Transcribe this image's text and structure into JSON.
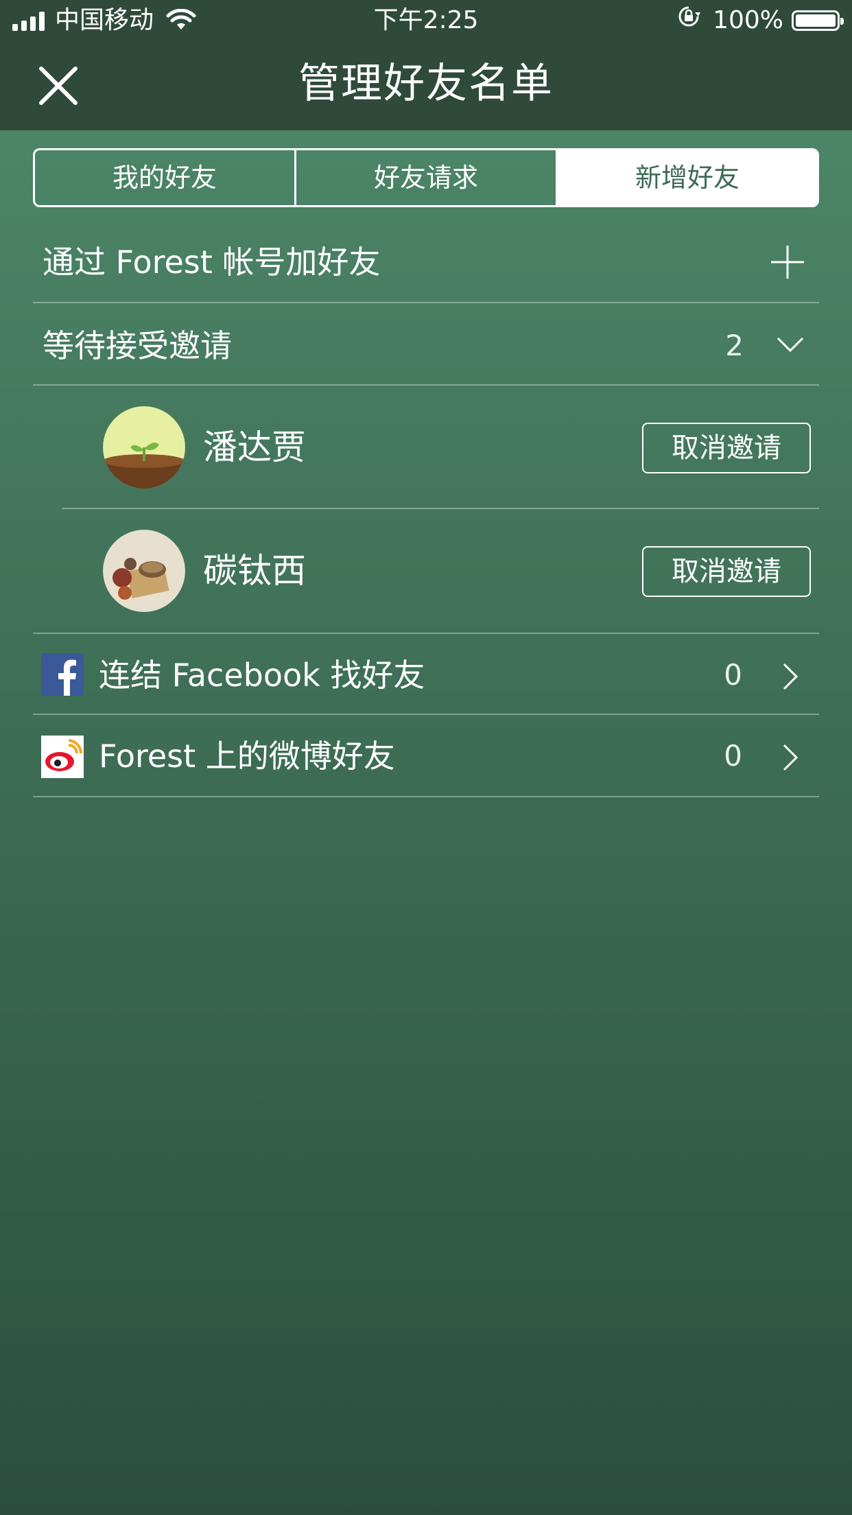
{
  "status_bar": {
    "carrier": "中国移动",
    "time": "下午2:25",
    "battery": "100%"
  },
  "header": {
    "title": "管理好友名单"
  },
  "tabs": [
    {
      "label": "我的好友",
      "active": false
    },
    {
      "label": "好友请求",
      "active": false
    },
    {
      "label": "新增好友",
      "active": true
    }
  ],
  "add_by_account": {
    "label": "通过 Forest 帐号加好友"
  },
  "pending": {
    "label": "等待接受邀请",
    "count": "2",
    "friends": [
      {
        "name": "潘达贾",
        "action": "取消邀请"
      },
      {
        "name": "碳钛西",
        "action": "取消邀请"
      }
    ]
  },
  "facebook": {
    "label": "连结 Facebook 找好友",
    "count": "0"
  },
  "weibo": {
    "label": "Forest 上的微博好友",
    "count": "0"
  },
  "colors": {
    "header_bg": "#2f4a3b",
    "body_top": "#4f8a6c",
    "body_bottom": "#2c4d3e",
    "facebook_blue": "#3b5998",
    "weibo_red": "#e6162d"
  }
}
